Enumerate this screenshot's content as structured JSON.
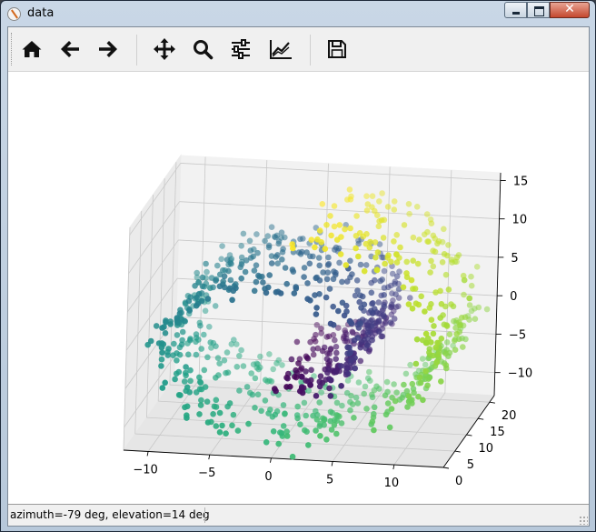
{
  "window": {
    "title": "data"
  },
  "toolbar": {
    "buttons": [
      {
        "name": "home-button",
        "icon": "home-icon"
      },
      {
        "name": "back-button",
        "icon": "arrow-left-icon"
      },
      {
        "name": "forward-button",
        "icon": "arrow-right-icon"
      },
      {
        "name": "pan-button",
        "icon": "move-icon"
      },
      {
        "name": "zoom-button",
        "icon": "magnifier-icon"
      },
      {
        "name": "configure-subplots-button",
        "icon": "sliders-icon"
      },
      {
        "name": "edit-axes-button",
        "icon": "line-chart-icon"
      },
      {
        "name": "save-button",
        "icon": "floppy-disk-icon"
      }
    ]
  },
  "status": {
    "text": "azimuth=-79 deg, elevation=14 deg"
  },
  "chart_data": {
    "type": "scatter",
    "projection": "3d",
    "title": "",
    "view": {
      "azimuth": -79,
      "elevation": 14
    },
    "colormap": "viridis",
    "xlim": [
      -12,
      14
    ],
    "ylim": [
      0,
      22
    ],
    "zlim": [
      -13,
      16
    ],
    "x_ticks": [
      "−10",
      "−5",
      "0",
      "5",
      "10"
    ],
    "y_ticks": [
      "0",
      "5",
      "10",
      "15",
      "20"
    ],
    "z_ticks": [
      "−10",
      "−5",
      "0",
      "5",
      "10",
      "15"
    ],
    "grid": true,
    "shape": "swiss-roll",
    "color_by": "t",
    "t_range": [
      4.7,
      14.1
    ],
    "n_points": 1000
  }
}
